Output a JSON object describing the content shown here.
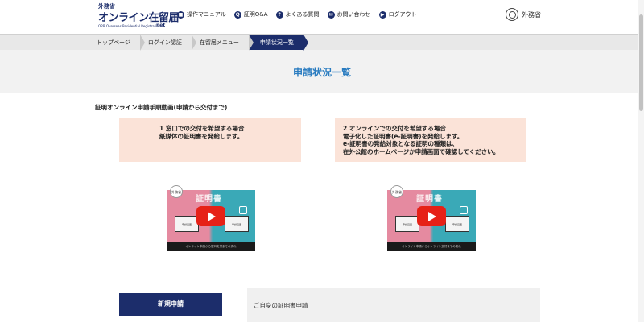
{
  "header": {
    "logo": {
      "small": "外務省",
      "main": "オンライン在留届",
      "sub": "ORR Overseas Residential Registration",
      "net": "net"
    },
    "nav": [
      {
        "label": "操作マニュアル",
        "icon": "book-icon",
        "glyph": "■"
      },
      {
        "label": "証明Q&A",
        "icon": "qa-icon",
        "glyph": "Q"
      },
      {
        "label": "よくある質問",
        "icon": "question-icon",
        "glyph": "?"
      },
      {
        "label": "お問い合わせ",
        "icon": "mail-icon",
        "glyph": "✉"
      },
      {
        "label": "ログアウト",
        "icon": "logout-icon",
        "glyph": "▶"
      }
    ],
    "mofa_label": "外務省"
  },
  "breadcrumb": [
    {
      "label": "トップページ"
    },
    {
      "label": "ログイン認証"
    },
    {
      "label": "在留届メニュー"
    },
    {
      "label": "申請状況一覧",
      "active": true
    }
  ],
  "page_title": "申請状況一覧",
  "section_heading": "証明オンライン申請手順動画(申請から交付まで)",
  "cards": [
    {
      "lines": [
        "1 窓口での交付を希望する場合",
        "紙媒体の証明書を発給します。"
      ]
    },
    {
      "lines": [
        "2 オンラインでの交付を希望する場合",
        "電子化した証明書(e-証明書)を発給します。",
        "e-証明書の発給対象となる証明の種類は、",
        "在外公館のホームページか申請画面で確認してください。"
      ]
    }
  ],
  "videos": [
    {
      "badge": "外務省",
      "title": "証明書",
      "laptop_left": "申請画面",
      "laptop_right": "申請画面",
      "caption": "オンライン申請から窓口交付までの流れ"
    },
    {
      "badge": "外務省",
      "title": "証明書",
      "laptop_left": "申請画面",
      "laptop_right": "申請画面",
      "caption": "オンライン申請からオンライン交付までの流れ"
    }
  ],
  "new_application": {
    "button_label": "新規申請",
    "description": "ご自身の証明書申請"
  },
  "colors": {
    "brand_navy": "#1c2d6b",
    "title_blue": "#2a7cc0",
    "card_peach": "#fbe3d8",
    "youtube_red": "#e62117"
  }
}
